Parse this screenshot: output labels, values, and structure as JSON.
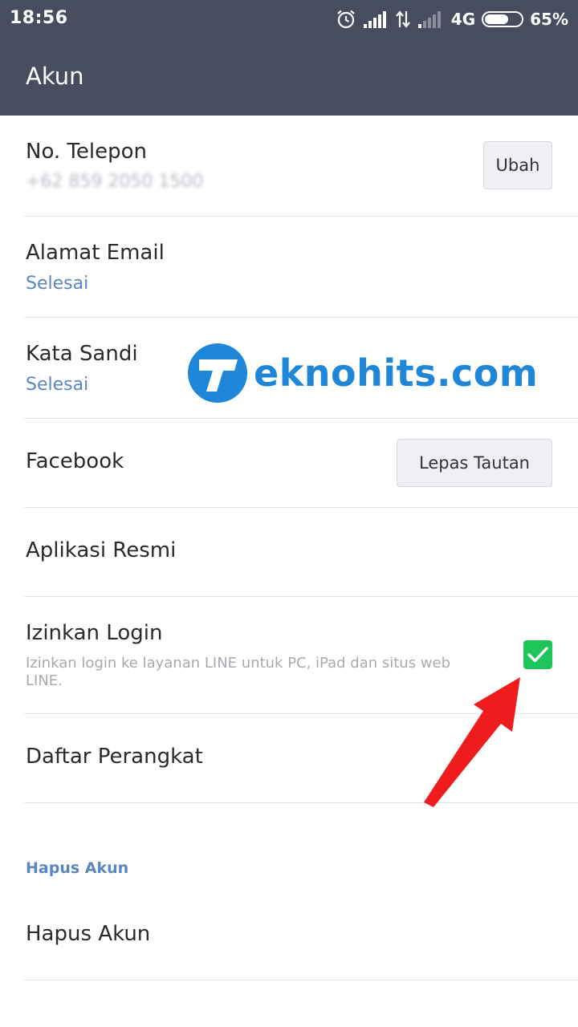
{
  "status_bar": {
    "time": "18:56",
    "network": "4G",
    "battery_percent": "65%",
    "battery_level": 0.65,
    "icons": [
      "alarm-icon",
      "signal-icon",
      "data-arrows-icon",
      "signal-weak-icon",
      "battery-icon"
    ]
  },
  "app_bar": {
    "title": "Akun"
  },
  "phone": {
    "title": "No. Telepon",
    "value": "+62 859 2050 1500",
    "button": "Ubah"
  },
  "email": {
    "title": "Alamat Email",
    "status": "Selesai"
  },
  "password": {
    "title": "Kata Sandi",
    "status": "Selesai"
  },
  "facebook": {
    "title": "Facebook",
    "button": "Lepas Tautan"
  },
  "official_apps": {
    "title": "Aplikasi Resmi"
  },
  "allow_login": {
    "title": "Izinkan Login",
    "description": "Izinkan login ke layanan LINE untuk PC, iPad dan situs web LINE.",
    "checked": true,
    "check_color": "#1ec55b"
  },
  "devices": {
    "title": "Daftar Perangkat"
  },
  "delete_section": {
    "label": "Hapus Akun",
    "item": "Hapus Akun"
  },
  "watermark": {
    "text": "eknohits.com",
    "color": "#1f86d8"
  },
  "colors": {
    "header": "#474c5f",
    "link": "#5b86bd",
    "annotation_arrow": "#ee1c1c"
  }
}
